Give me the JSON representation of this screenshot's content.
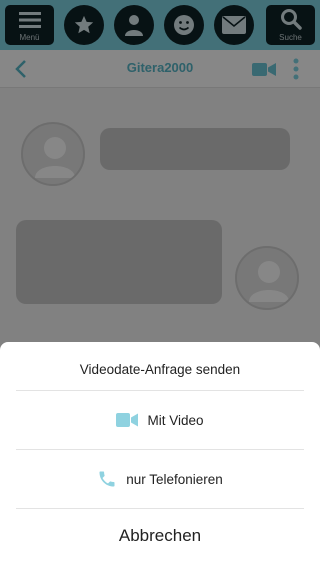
{
  "topbar": {
    "menu_label": "Menü",
    "search_label": "Suche",
    "icons": [
      "hamburger-menu-icon",
      "star-icon",
      "user-icon",
      "smiley-icon",
      "envelope-icon",
      "magnifier-icon"
    ]
  },
  "chat": {
    "username": "Gitera2000",
    "icons": [
      "back-chevron-icon",
      "video-camera-icon",
      "vertical-dots-icon"
    ]
  },
  "sheet": {
    "title": "Videodate-Anfrage senden",
    "options": [
      {
        "label": "Mit Video",
        "icon": "video-camera-icon"
      },
      {
        "label": "nur Telefonieren",
        "icon": "phone-icon"
      }
    ],
    "cancel_label": "Abbrechen"
  },
  "colors": {
    "accent": "#7fd3e3",
    "accent_dark": "#58b7c8",
    "icon_blue": "#8fd2e0",
    "overlay": "rgba(0,0,0,0.47)",
    "sheet_bg": "#ffffff"
  }
}
